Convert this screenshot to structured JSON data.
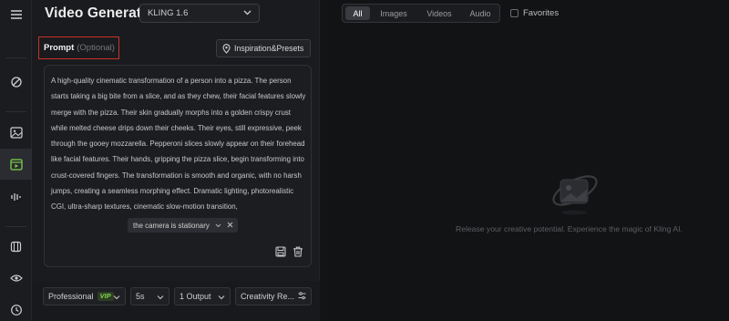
{
  "app": {
    "title": "Video Generation",
    "model": "KLING 1.6"
  },
  "rail": {
    "icons": [
      "menu-icon",
      "effects-icon",
      "image-icon",
      "video-icon",
      "audio-icon",
      "assets-icon",
      "eye-icon",
      "history-icon"
    ]
  },
  "prompt": {
    "label": "Prompt",
    "optional_label": "(Optional)",
    "inspiration_button": "Inspiration&Presets",
    "text": "A high-quality cinematic transformation of a person into a pizza. The person starts taking a big bite from a slice, and as they chew, their facial features slowly merge with the pizza. Their skin gradually morphs into a golden crispy crust while melted cheese drips down their cheeks. Their eyes, still expressive, peek through the gooey mozzarella. Pepperoni slices slowly appear on their forehead like facial features. Their hands, gripping the pizza slice, begin transforming into crust-covered fingers. The transformation is smooth and organic, with no harsh jumps, creating a seamless morphing effect. Dramatic lighting, photorealistic CGI, ultra-sharp textures, cinematic slow-motion transition,",
    "chip": "the camera is stationary"
  },
  "settings": {
    "mode": "Professional",
    "mode_badge": "VIP",
    "duration": "5s",
    "outputs": "1 Output",
    "creativity": "Creativity Re..."
  },
  "gallery": {
    "tabs": [
      "All",
      "Images",
      "Videos",
      "Audio"
    ],
    "active_tab": "All",
    "favorites_label": "Favorites",
    "empty_message": "Release your creative potential. Experience the magic of Kling AI."
  },
  "colors": {
    "accent_red": "#c8302b",
    "vip_green": "#7dd24a",
    "background": "#141518"
  }
}
